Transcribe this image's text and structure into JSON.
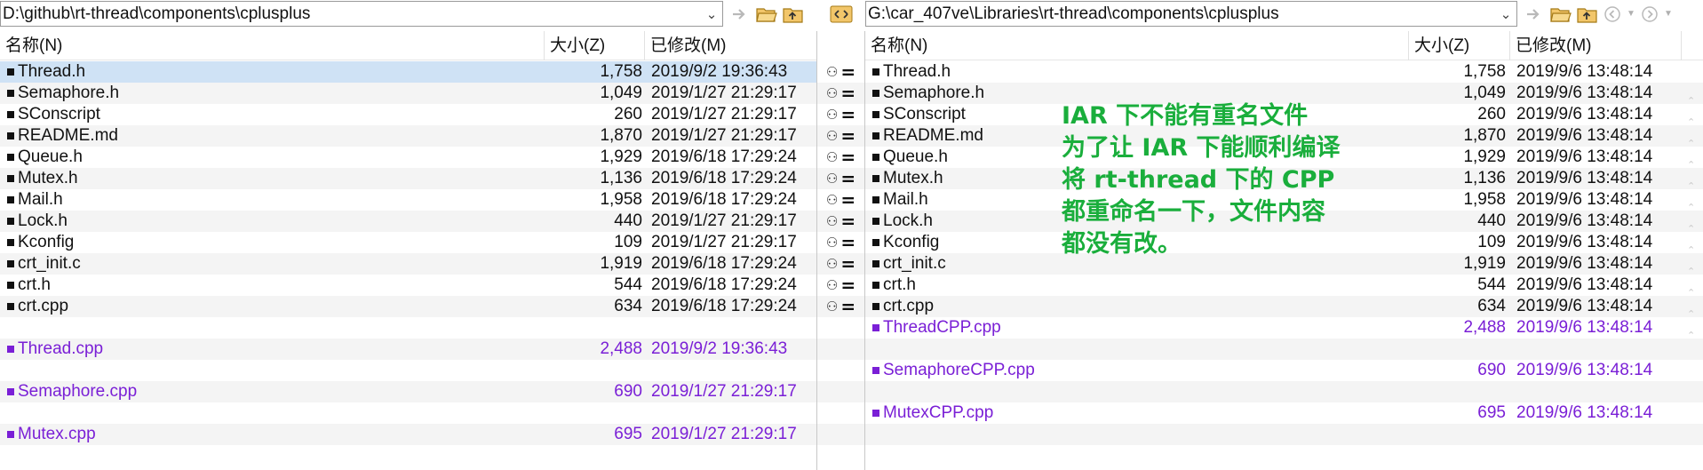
{
  "left": {
    "path": "D:\\github\\rt-thread\\components\\cplusplus",
    "columns": {
      "name": "名称(N)",
      "size": "大小(Z)",
      "modified": "已修改(M)"
    },
    "rows": [
      {
        "name": "Thread.h",
        "size": "1,758",
        "modified": "2019/9/2 19:36:43"
      },
      {
        "name": "Semaphore.h",
        "size": "1,049",
        "modified": "2019/1/27 21:29:17"
      },
      {
        "name": "SConscript",
        "size": "260",
        "modified": "2019/1/27 21:29:17"
      },
      {
        "name": "README.md",
        "size": "1,870",
        "modified": "2019/1/27 21:29:17"
      },
      {
        "name": "Queue.h",
        "size": "1,929",
        "modified": "2019/6/18 17:29:24"
      },
      {
        "name": "Mutex.h",
        "size": "1,136",
        "modified": "2019/6/18 17:29:24"
      },
      {
        "name": "Mail.h",
        "size": "1,958",
        "modified": "2019/6/18 17:29:24"
      },
      {
        "name": "Lock.h",
        "size": "440",
        "modified": "2019/1/27 21:29:17"
      },
      {
        "name": "Kconfig",
        "size": "109",
        "modified": "2019/1/27 21:29:17"
      },
      {
        "name": "crt_init.c",
        "size": "1,919",
        "modified": "2019/6/18 17:29:24"
      },
      {
        "name": "crt.h",
        "size": "544",
        "modified": "2019/6/18 17:29:24"
      },
      {
        "name": "crt.cpp",
        "size": "634",
        "modified": "2019/6/18 17:29:24"
      }
    ],
    "orphans": [
      {
        "name": "Thread.cpp",
        "size": "2,488",
        "modified": "2019/9/2 19:36:43"
      },
      {
        "name": "Semaphore.cpp",
        "size": "690",
        "modified": "2019/1/27 21:29:17"
      },
      {
        "name": "Mutex.cpp",
        "size": "695",
        "modified": "2019/1/27 21:29:17"
      }
    ]
  },
  "right": {
    "path": "G:\\car_407ve\\Libraries\\rt-thread\\components\\cplusplus",
    "columns": {
      "name": "名称(N)",
      "size": "大小(Z)",
      "modified": "已修改(M)"
    },
    "rows": [
      {
        "name": "Thread.h",
        "size": "1,758",
        "modified": "2019/9/6 13:48:14"
      },
      {
        "name": "Semaphore.h",
        "size": "1,049",
        "modified": "2019/9/6 13:48:14"
      },
      {
        "name": "SConscript",
        "size": "260",
        "modified": "2019/9/6 13:48:14"
      },
      {
        "name": "README.md",
        "size": "1,870",
        "modified": "2019/9/6 13:48:14"
      },
      {
        "name": "Queue.h",
        "size": "1,929",
        "modified": "2019/9/6 13:48:14"
      },
      {
        "name": "Mutex.h",
        "size": "1,136",
        "modified": "2019/9/6 13:48:14"
      },
      {
        "name": "Mail.h",
        "size": "1,958",
        "modified": "2019/9/6 13:48:14"
      },
      {
        "name": "Lock.h",
        "size": "440",
        "modified": "2019/9/6 13:48:14"
      },
      {
        "name": "Kconfig",
        "size": "109",
        "modified": "2019/9/6 13:48:14"
      },
      {
        "name": "crt_init.c",
        "size": "1,919",
        "modified": "2019/9/6 13:48:14"
      },
      {
        "name": "crt.h",
        "size": "544",
        "modified": "2019/9/6 13:48:14"
      },
      {
        "name": "crt.cpp",
        "size": "634",
        "modified": "2019/9/6 13:48:14"
      }
    ],
    "orphans": [
      {
        "name": "ThreadCPP.cpp",
        "size": "2,488",
        "modified": "2019/9/6 13:48:14"
      },
      {
        "name": "SemaphoreCPP.cpp",
        "size": "690",
        "modified": "2019/9/6 13:48:14"
      },
      {
        "name": "MutexCPP.cpp",
        "size": "695",
        "modified": "2019/9/6 13:48:14"
      }
    ]
  },
  "annotation": {
    "lines": [
      "IAR 下不能有重名文件",
      "为了让 IAR 下能顺利编译",
      "将 rt-thread 下的 CPP",
      "都重命名一下，文件内容",
      "都没有改。"
    ]
  },
  "colors": {
    "orphan": "#7a1fd6",
    "annotation": "#1aae3c",
    "selected_row": "#cfe2f5"
  },
  "icons": [
    "chevron-down-icon",
    "copy-arrow-icon",
    "open-folder-icon",
    "parent-folder-icon",
    "swap-sides-icon",
    "back-icon",
    "forward-icon",
    "compare-icon",
    "equal-icon"
  ]
}
